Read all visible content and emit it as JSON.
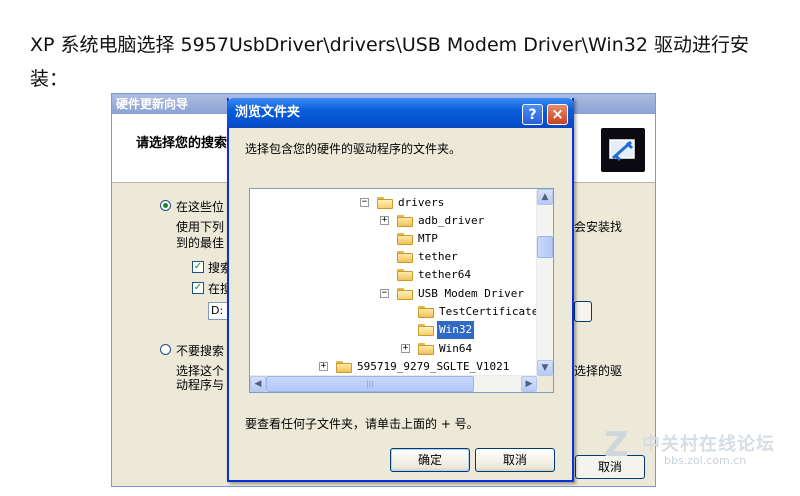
{
  "document": {
    "line1": "XP 系统电脑选择 5957UsbDriver\\drivers\\USB Modem Driver\\Win32 驱动进行安",
    "line2": "装："
  },
  "wizard": {
    "title": "硬件更新向导",
    "header_title": "请选择您的搜索",
    "radio_search_label": "在这些位",
    "search_desc_line1": "使用下列",
    "search_desc_line2": "到的最佳",
    "search_desc_right": "会安装找",
    "check1_label": "搜索",
    "check2_label": "在搜",
    "path_value": "D:",
    "radio_nosearch_label": "不要搜索",
    "nosearch_desc_line1": "选择这个",
    "nosearch_desc_line2": "动程序与",
    "nosearch_desc_right": "选择的驱",
    "cancel_label": "取消"
  },
  "dialog": {
    "title": "浏览文件夹",
    "instruction": "选择包含您的硬件的驱动程序的文件夹。",
    "hint": "要查看任何子文件夹，请单击上面的 + 号。",
    "ok_label": "确定",
    "cancel_label": "取消",
    "help_glyph": "?",
    "close_glyph": "×"
  },
  "tree": {
    "nodes": [
      {
        "label": "drivers",
        "expander": "−",
        "open": true
      },
      {
        "label": "adb_driver",
        "expander": "+",
        "open": false
      },
      {
        "label": "MTP",
        "expander": "",
        "open": false
      },
      {
        "label": "tether",
        "expander": "",
        "open": false
      },
      {
        "label": "tether64",
        "expander": "",
        "open": false
      },
      {
        "label": "USB Modem Driver",
        "expander": "−",
        "open": true
      },
      {
        "label": "TestCertificate",
        "expander": "",
        "open": false
      },
      {
        "label": "Win32",
        "expander": "",
        "open": true,
        "selected": true
      },
      {
        "label": "Win64",
        "expander": "+",
        "open": false
      },
      {
        "label": "595719_9279_SGLTE_V1021",
        "expander": "+",
        "open": false
      }
    ]
  },
  "scrollbars": {
    "up": "▲",
    "down": "▼",
    "left": "◀",
    "right": "▶",
    "grip": "|||"
  },
  "watermark": {
    "site": "中关村在线论坛",
    "url": "bbs.zol.com.cn",
    "logo": "Z"
  }
}
